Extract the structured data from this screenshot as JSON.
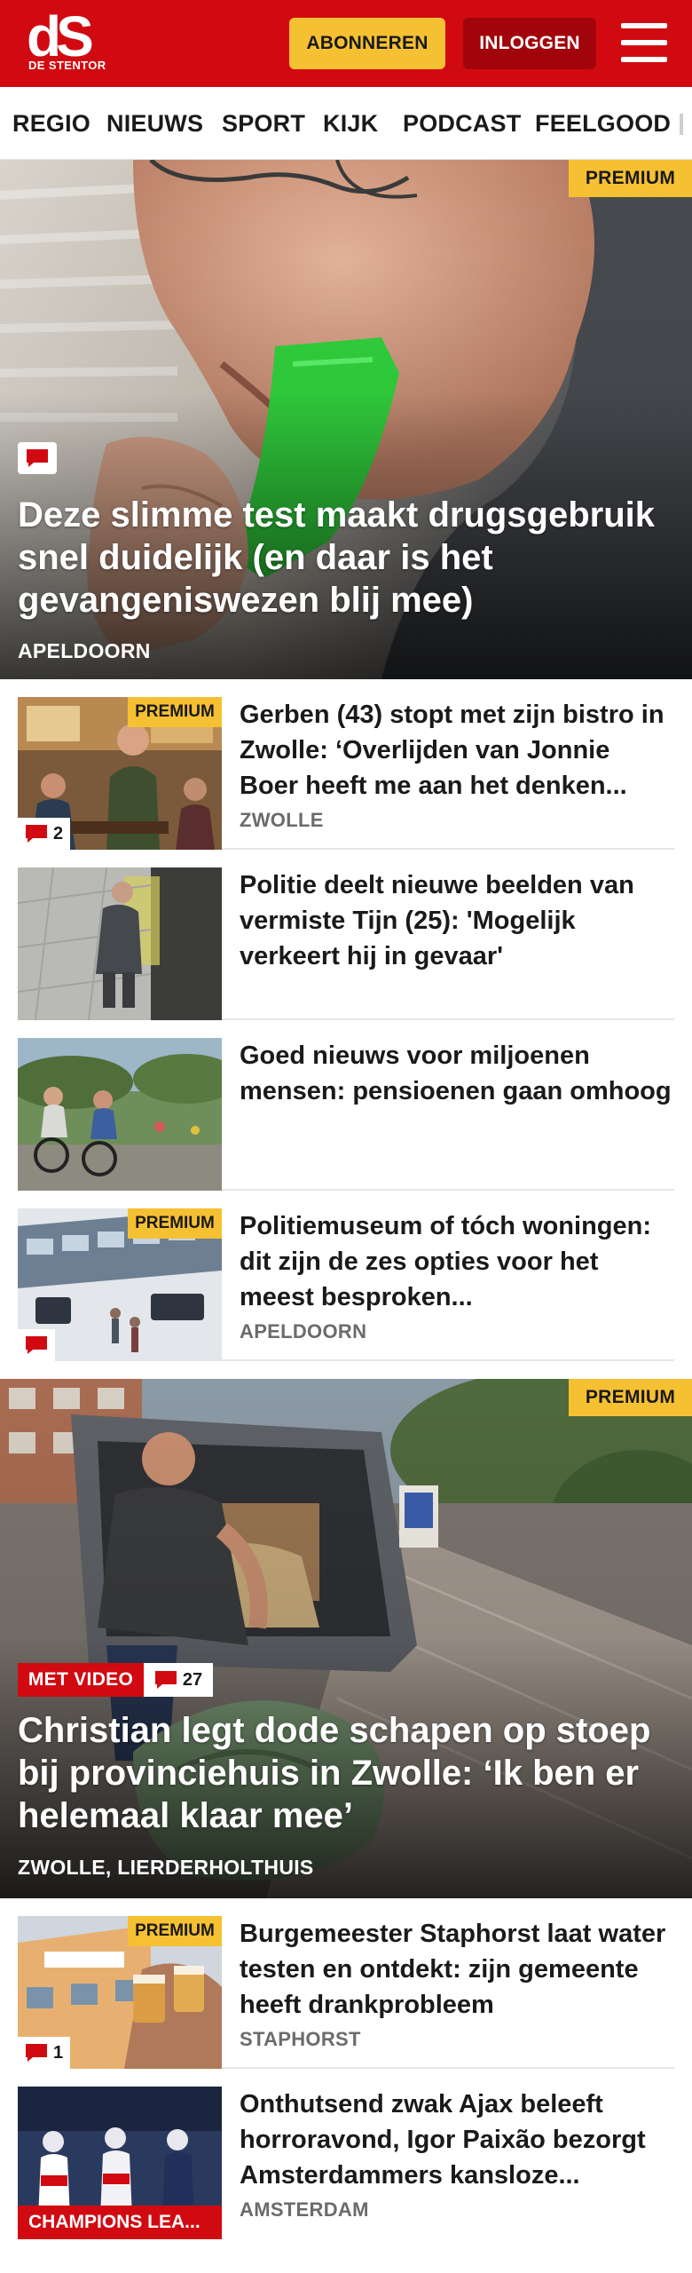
{
  "header": {
    "logo_mark": "dS",
    "logo_text": "DE STENTOR",
    "subscribe_label": "ABONNEREN",
    "login_label": "INLOGGEN",
    "menu_icon": "hamburger-menu-icon",
    "brand_color": "#d10a11",
    "accent_color": "#f6c033"
  },
  "nav": {
    "items": [
      "REGIO",
      "NIEUWS",
      "SPORT",
      "KIJK",
      "PODCAST",
      "FEELGOOD"
    ]
  },
  "hero1": {
    "badge": "PREMIUM",
    "comment_icon": "comment-icon",
    "title": "Deze slimme test maakt drugsgebruik snel duidelijk (en daar is het gevangeniswezen blij mee)",
    "location": "APELDOORN"
  },
  "articles1": [
    {
      "title": "Gerben (43) stopt met zijn bistro in Zwolle: ‘Overlijden van Jonnie Boer heeft me aan het denken...",
      "location": "ZWOLLE",
      "badge": "PREMIUM",
      "comments": "2"
    },
    {
      "title": "Politie deelt nieuwe beelden van vermiste Tijn (25): 'Mogelijk verkeert hij in gevaar'",
      "location": "",
      "badge": "",
      "comments": ""
    },
    {
      "title": "Goed nieuws voor miljoenen mensen: pensioenen gaan omhoog",
      "location": "",
      "badge": "",
      "comments": ""
    },
    {
      "title": "Politiemuseum of tóch woningen: dit zijn de zes opties voor het meest besproken...",
      "location": "APELDOORN",
      "badge": "PREMIUM",
      "comments": ""
    }
  ],
  "hero2": {
    "badge": "PREMIUM",
    "video_label": "MET VIDEO",
    "comments": "27",
    "title": "Christian legt dode schapen op stoep bij provinciehuis in Zwolle: ‘Ik ben er helemaal klaar mee’",
    "location": "ZWOLLE, LIERDERHOLTHUIS"
  },
  "articles2": [
    {
      "title": "Burgemeester Staphorst laat water testen en ontdekt: zijn gemeente heeft drankprobleem",
      "location": "STAPHORST",
      "badge": "PREMIUM",
      "comments": "1"
    },
    {
      "title": "Onthutsend zwak Ajax beleeft horroravond, Igor Paixão bezorgt Amsterdammers kansloze...",
      "location": "AMSTERDAM",
      "label": "CHAMPIONS LEA..."
    }
  ]
}
